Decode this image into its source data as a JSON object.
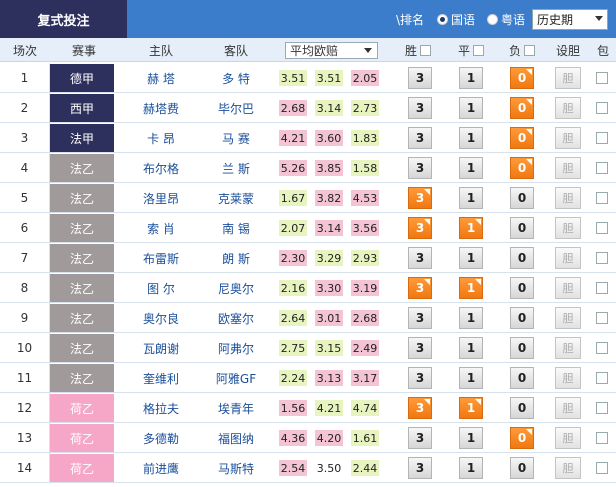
{
  "header": {
    "title": "复式投注",
    "rank_label": "\\排名",
    "lang1": "国语",
    "lang2": "粤语",
    "period": "历史期"
  },
  "columns": {
    "num": "场次",
    "league": "赛事",
    "home": "主队",
    "away": "客队",
    "avg_odds": "平均欧赔",
    "win": "胜",
    "draw": "平",
    "lose": "负",
    "banker": "设胆",
    "include": "包"
  },
  "colors": {
    "bar": "#3b7ccb",
    "title_bg": "#2d2f5c",
    "league_dark": "#2d2f5c",
    "league_gray": "#9a9a9a",
    "league_pink": "#f6a6c6",
    "selected": "#f07810"
  },
  "banker_label": "胆",
  "rows": [
    {
      "num": "1",
      "league": "德甲",
      "lcolor": "#2d2f5c",
      "home": "赫 塔",
      "away": "多 特",
      "o1": "3.51",
      "o2": "3.51",
      "o3": "2.05",
      "c1": "md",
      "c2": "md",
      "c3": "hi",
      "w": "3",
      "d": "1",
      "l": "0",
      "sw": false,
      "sd": false,
      "sl": true
    },
    {
      "num": "2",
      "league": "西甲",
      "lcolor": "#2d2f5c",
      "home": "赫塔费",
      "away": "毕尔巴",
      "o1": "2.68",
      "o2": "3.14",
      "o3": "2.73",
      "c1": "hi",
      "c2": "md",
      "c3": "md",
      "w": "3",
      "d": "1",
      "l": "0",
      "sw": false,
      "sd": false,
      "sl": true
    },
    {
      "num": "3",
      "league": "法甲",
      "lcolor": "#2d2f5c",
      "home": "卡 昂",
      "away": "马 赛",
      "o1": "4.21",
      "o2": "3.60",
      "o3": "1.83",
      "c1": "hi",
      "c2": "hi",
      "c3": "md",
      "w": "3",
      "d": "1",
      "l": "0",
      "sw": false,
      "sd": false,
      "sl": true
    },
    {
      "num": "4",
      "league": "法乙",
      "lcolor": "#a09a9a",
      "home": "布尔格",
      "away": "兰 斯",
      "o1": "5.26",
      "o2": "3.85",
      "o3": "1.58",
      "c1": "hi",
      "c2": "hi",
      "c3": "md",
      "w": "3",
      "d": "1",
      "l": "0",
      "sw": false,
      "sd": false,
      "sl": true
    },
    {
      "num": "5",
      "league": "法乙",
      "lcolor": "#a09a9a",
      "home": "洛里昂",
      "away": "克莱蒙",
      "o1": "1.67",
      "o2": "3.82",
      "o3": "4.53",
      "c1": "md",
      "c2": "hi",
      "c3": "hi",
      "w": "3",
      "d": "1",
      "l": "0",
      "sw": true,
      "sd": false,
      "sl": false
    },
    {
      "num": "6",
      "league": "法乙",
      "lcolor": "#a09a9a",
      "home": "索 肖",
      "away": "南 锡",
      "o1": "2.07",
      "o2": "3.14",
      "o3": "3.56",
      "c1": "md",
      "c2": "hi",
      "c3": "hi",
      "w": "3",
      "d": "1",
      "l": "0",
      "sw": true,
      "sd": true,
      "sl": false
    },
    {
      "num": "7",
      "league": "法乙",
      "lcolor": "#a09a9a",
      "home": "布雷斯",
      "away": "朗 斯",
      "o1": "2.30",
      "o2": "3.29",
      "o3": "2.93",
      "c1": "hi",
      "c2": "md",
      "c3": "md",
      "w": "3",
      "d": "1",
      "l": "0",
      "sw": false,
      "sd": false,
      "sl": false
    },
    {
      "num": "8",
      "league": "法乙",
      "lcolor": "#a09a9a",
      "home": "图 尔",
      "away": "尼奥尔",
      "o1": "2.16",
      "o2": "3.30",
      "o3": "3.19",
      "c1": "md",
      "c2": "hi",
      "c3": "hi",
      "w": "3",
      "d": "1",
      "l": "0",
      "sw": true,
      "sd": true,
      "sl": false
    },
    {
      "num": "9",
      "league": "法乙",
      "lcolor": "#a09a9a",
      "home": "奥尔良",
      "away": "欧塞尔",
      "o1": "2.64",
      "o2": "3.01",
      "o3": "2.68",
      "c1": "md",
      "c2": "hi",
      "c3": "hi",
      "w": "3",
      "d": "1",
      "l": "0",
      "sw": false,
      "sd": false,
      "sl": false
    },
    {
      "num": "10",
      "league": "法乙",
      "lcolor": "#a09a9a",
      "home": "瓦朗谢",
      "away": "阿弗尔",
      "o1": "2.75",
      "o2": "3.15",
      "o3": "2.49",
      "c1": "md",
      "c2": "md",
      "c3": "hi",
      "w": "3",
      "d": "1",
      "l": "0",
      "sw": false,
      "sd": false,
      "sl": false
    },
    {
      "num": "11",
      "league": "法乙",
      "lcolor": "#a09a9a",
      "home": "奎维利",
      "away": "阿雅GF",
      "o1": "2.24",
      "o2": "3.13",
      "o3": "3.17",
      "c1": "md",
      "c2": "hi",
      "c3": "hi",
      "w": "3",
      "d": "1",
      "l": "0",
      "sw": false,
      "sd": false,
      "sl": false
    },
    {
      "num": "12",
      "league": "荷乙",
      "lcolor": "#f6a6c6",
      "home": "格拉夫",
      "away": "埃青年",
      "o1": "1.56",
      "o2": "4.21",
      "o3": "4.74",
      "c1": "hi",
      "c2": "md",
      "c3": "md",
      "w": "3",
      "d": "1",
      "l": "0",
      "sw": true,
      "sd": true,
      "sl": false
    },
    {
      "num": "13",
      "league": "荷乙",
      "lcolor": "#f6a6c6",
      "home": "多德勒",
      "away": "福图纳",
      "o1": "4.36",
      "o2": "4.20",
      "o3": "1.61",
      "c1": "hi",
      "c2": "hi",
      "c3": "md",
      "w": "3",
      "d": "1",
      "l": "0",
      "sw": false,
      "sd": false,
      "sl": true
    },
    {
      "num": "14",
      "league": "荷乙",
      "lcolor": "#f6a6c6",
      "home": "前进鹰",
      "away": "马斯特",
      "o1": "2.54",
      "o2": "3.50",
      "o3": "2.44",
      "c1": "hi",
      "c2": "none",
      "c3": "md",
      "w": "3",
      "d": "1",
      "l": "0",
      "sw": false,
      "sd": false,
      "sl": false
    }
  ]
}
